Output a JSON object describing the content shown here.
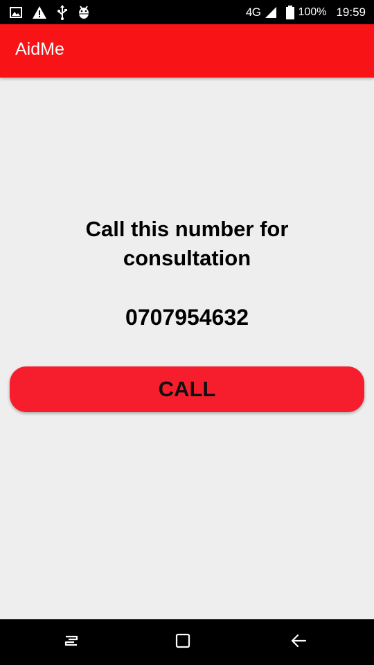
{
  "status_bar": {
    "icons_left": [
      "image-icon",
      "warning-icon",
      "usb-icon",
      "android-debug-icon"
    ],
    "network": "4G",
    "battery": "100%",
    "time": "19:59"
  },
  "app_bar": {
    "title": "AidMe",
    "color": "#f71316"
  },
  "main": {
    "heading": "Call this number for consultation",
    "phone_number": "0707954632",
    "call_button_label": "CALL",
    "call_button_color": "#f61d2c"
  },
  "nav_bar": {
    "buttons": [
      "recents-icon",
      "home-icon",
      "back-icon"
    ]
  }
}
